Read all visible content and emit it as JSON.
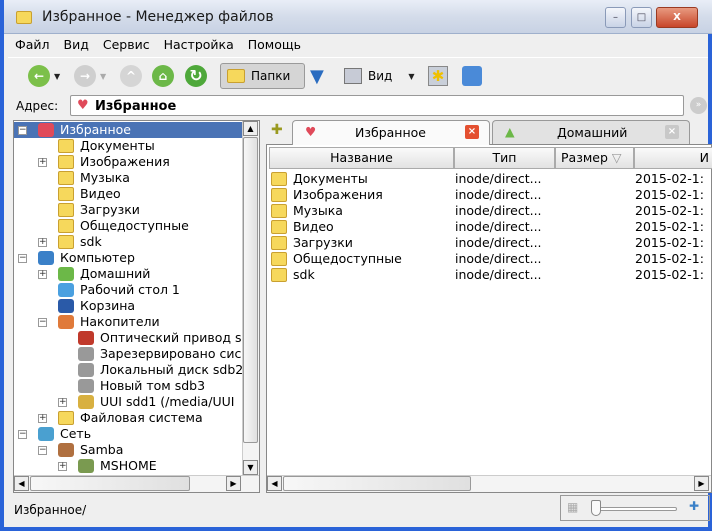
{
  "window": {
    "title": "Избранное - Менеджер файлов",
    "min": "–",
    "max": "□",
    "close": "X"
  },
  "menu": [
    "Файл",
    "Вид",
    "Сервис",
    "Настройка",
    "Помощь"
  ],
  "toolbar": {
    "folders_label": "Папки",
    "view_label": "Вид"
  },
  "address": {
    "label": "Адрес:",
    "value": "Избранное"
  },
  "tree": [
    {
      "label": "Избранное",
      "level": 0,
      "exp": "−",
      "icon": "heart-icon",
      "selected": true
    },
    {
      "label": "Документы",
      "level": 1,
      "exp": "",
      "icon": "documents-folder-icon"
    },
    {
      "label": "Изображения",
      "level": 1,
      "exp": "+",
      "icon": "pictures-folder-icon"
    },
    {
      "label": "Музыка",
      "level": 1,
      "exp": "",
      "icon": "music-folder-icon"
    },
    {
      "label": "Видео",
      "level": 1,
      "exp": "",
      "icon": "video-folder-icon"
    },
    {
      "label": "Загрузки",
      "level": 1,
      "exp": "",
      "icon": "downloads-folder-icon"
    },
    {
      "label": "Общедоступные",
      "level": 1,
      "exp": "",
      "icon": "public-folder-icon"
    },
    {
      "label": "sdk",
      "level": 1,
      "exp": "+",
      "icon": "folder-icon"
    },
    {
      "label": "Компьютер",
      "level": 0,
      "exp": "−",
      "icon": "computer-icon"
    },
    {
      "label": "Домашний",
      "level": 1,
      "exp": "+",
      "icon": "home-icon"
    },
    {
      "label": "Рабочий стол 1",
      "level": 1,
      "exp": "",
      "icon": "desktop-icon"
    },
    {
      "label": "Корзина",
      "level": 1,
      "exp": "",
      "icon": "trash-icon"
    },
    {
      "label": "Накопители",
      "level": 1,
      "exp": "−",
      "icon": "drives-icon"
    },
    {
      "label": "Оптический привод s",
      "level": 2,
      "exp": "",
      "icon": "optical-drive-icon"
    },
    {
      "label": "Зарезервировано сис",
      "level": 2,
      "exp": "",
      "icon": "hard-disk-icon"
    },
    {
      "label": "Локальный диск sdb2",
      "level": 2,
      "exp": "",
      "icon": "hard-disk-icon"
    },
    {
      "label": "Новый том sdb3",
      "level": 2,
      "exp": "",
      "icon": "hard-disk-icon"
    },
    {
      "label": "UUI sdd1 (/media/UUI",
      "level": 2,
      "exp": "+",
      "icon": "usb-drive-icon"
    },
    {
      "label": "Файловая система",
      "level": 1,
      "exp": "+",
      "icon": "folder-icon"
    },
    {
      "label": "Сеть",
      "level": 0,
      "exp": "−",
      "icon": "network-icon"
    },
    {
      "label": "Samba",
      "level": 1,
      "exp": "−",
      "icon": "samba-icon"
    },
    {
      "label": "MSHOME",
      "level": 2,
      "exp": "+",
      "icon": "workgroup-icon"
    }
  ],
  "tabs": [
    {
      "label": "Избранное",
      "active": true
    },
    {
      "label": "Домашний",
      "active": false
    }
  ],
  "columns": [
    "Название",
    "Тип",
    "Размер",
    "И"
  ],
  "files": [
    {
      "name": "Документы",
      "type": "inode/direct...",
      "date": "2015-02-1:"
    },
    {
      "name": "Изображения",
      "type": "inode/direct...",
      "date": "2015-02-1:"
    },
    {
      "name": "Музыка",
      "type": "inode/direct...",
      "date": "2015-02-1:"
    },
    {
      "name": "Видео",
      "type": "inode/direct...",
      "date": "2015-02-1:"
    },
    {
      "name": "Загрузки",
      "type": "inode/direct...",
      "date": "2015-02-1:"
    },
    {
      "name": "Общедоступные",
      "type": "inode/direct...",
      "date": "2015-02-1:"
    },
    {
      "name": "sdk",
      "type": "inode/direct...",
      "date": "2015-02-1:"
    }
  ],
  "status": {
    "path": "Избранное/",
    "zoom_level": 0
  }
}
